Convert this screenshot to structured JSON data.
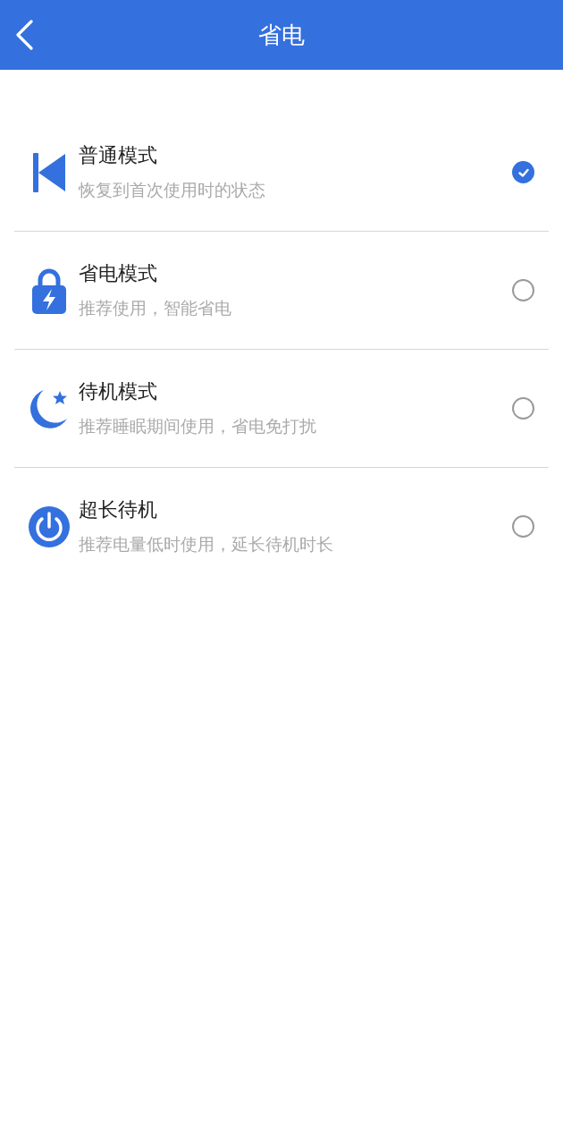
{
  "header": {
    "title": "省电"
  },
  "modes": [
    {
      "title": "普通模式",
      "subtitle": "恢复到首次使用时的状态",
      "selected": true
    },
    {
      "title": "省电模式",
      "subtitle": "推荐使用，智能省电",
      "selected": false
    },
    {
      "title": "待机模式",
      "subtitle": "推荐睡眠期间使用，省电免打扰",
      "selected": false
    },
    {
      "title": "超长待机",
      "subtitle": "推荐电量低时使用，延长待机时长",
      "selected": false
    }
  ]
}
